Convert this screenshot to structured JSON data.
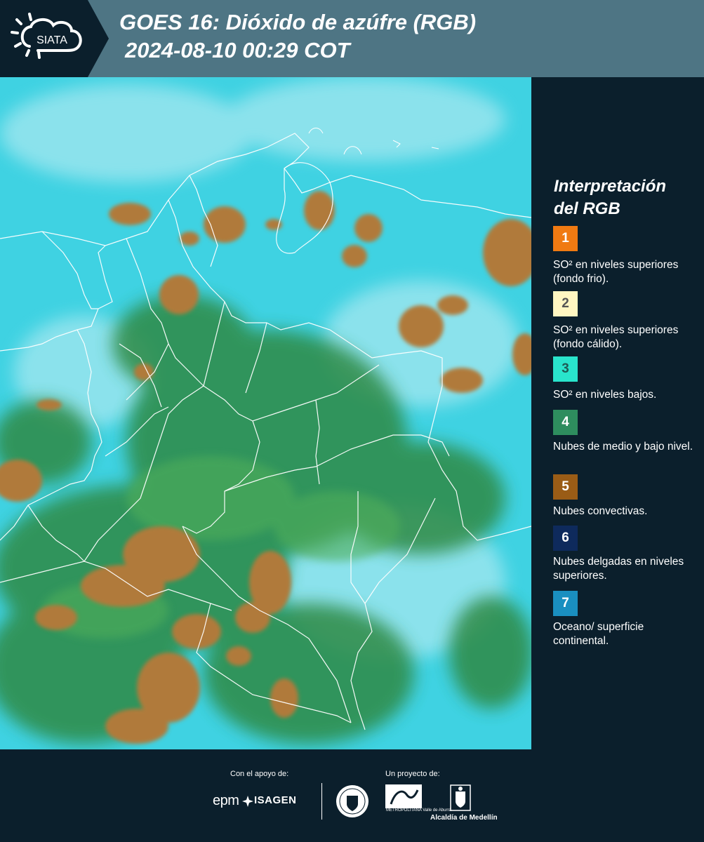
{
  "header": {
    "logo_text": "SIATA",
    "title_line1": "GOES 16: Dióxido de azúfre (RGB)",
    "title_line2": "2024-08-10 00:29 COT"
  },
  "legend": {
    "title_line1": "Interpretación",
    "title_line2": "del RGB",
    "items": [
      {
        "number": "1",
        "color": "#f07a12",
        "text": "SO² en niveles superiores (fondo frio)."
      },
      {
        "number": "2",
        "color": "#fff6c2",
        "text": "SO² en niveles superiores (fondo cálido)."
      },
      {
        "number": "3",
        "color": "#29e4cc",
        "text": "SO² en niveles bajos."
      },
      {
        "number": "4",
        "color": "#2e8d5e",
        "text": "Nubes de medio y bajo nivel."
      },
      {
        "number": "5",
        "color": "#9a5c16",
        "text": "Nubes convectivas."
      },
      {
        "number": "6",
        "color": "#0e2a5c",
        "text": "Nubes delgadas en niveles superiores."
      },
      {
        "number": "7",
        "color": "#1a8fc0",
        "text": "Oceano/ superficie continental."
      }
    ]
  },
  "footer": {
    "support_label": "Con el apoyo de:",
    "project_label": "Un proyecto de:",
    "sponsor1": "epm",
    "sponsor2": "ISAGEN",
    "partner_area": "METROPOLITANA Valle de Aburrá",
    "partner_alcaldia": "Alcaldía de Medellín"
  },
  "map": {
    "colors": {
      "background": "#3fd2e2",
      "green": "#2f8a45",
      "convective": "#b07a3a",
      "border": "#ffffff"
    }
  }
}
